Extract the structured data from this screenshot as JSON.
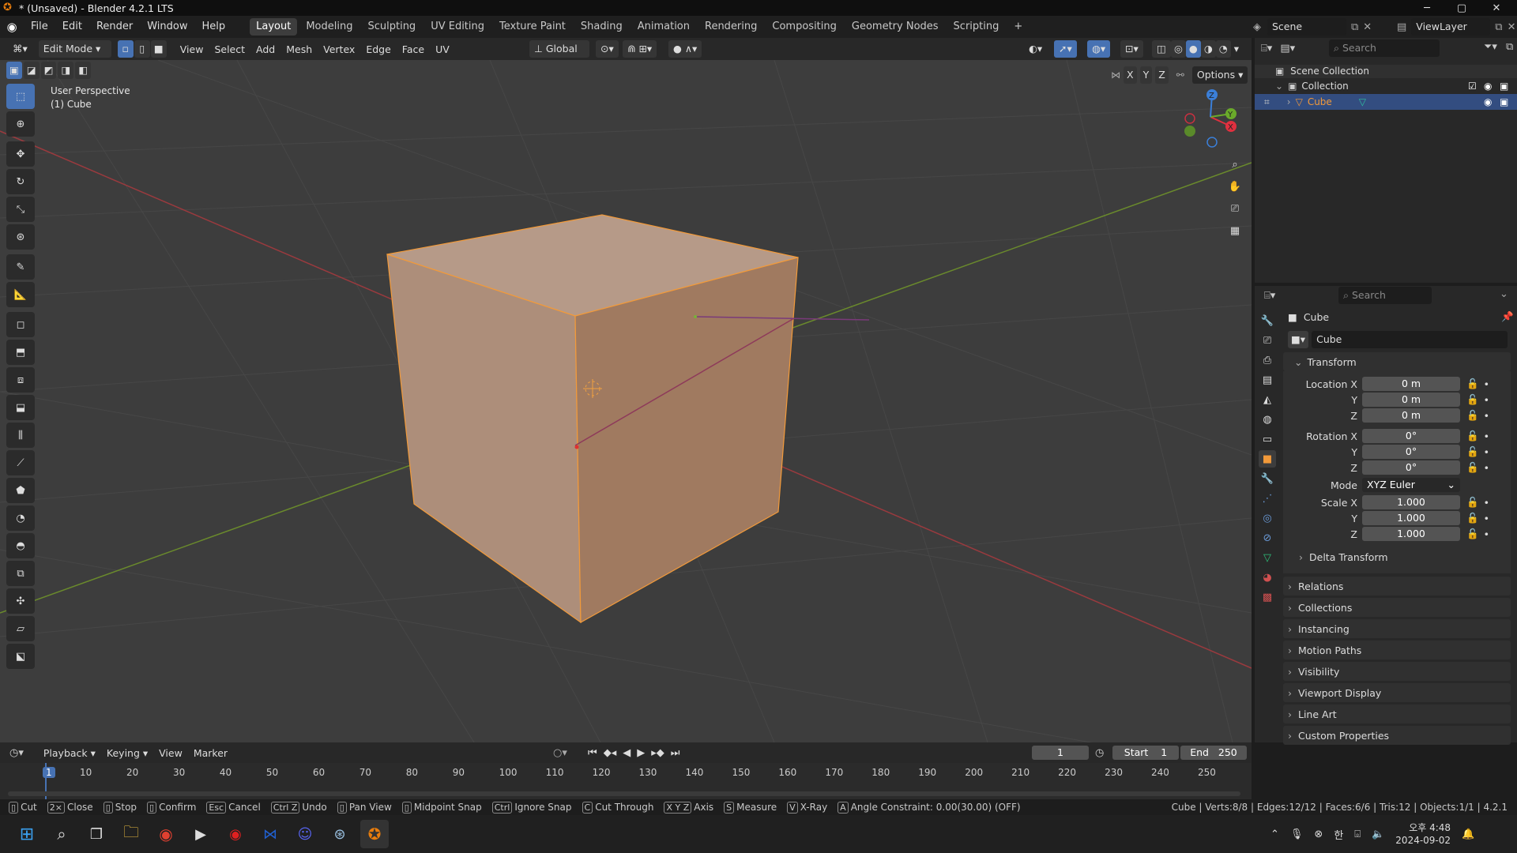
{
  "window": {
    "title": "* (Unsaved) - Blender 4.2.1 LTS",
    "controls": {
      "minimize": "─",
      "maximize": "▢",
      "close": "✕"
    }
  },
  "menubar": {
    "menus": [
      "File",
      "Edit",
      "Render",
      "Window",
      "Help"
    ],
    "workspaces": [
      "Layout",
      "Modeling",
      "Sculpting",
      "UV Editing",
      "Texture Paint",
      "Shading",
      "Animation",
      "Rendering",
      "Compositing",
      "Geometry Nodes",
      "Scripting"
    ],
    "active_workspace": "Layout",
    "add_tab": "+",
    "scene": "Scene",
    "view_layer": "ViewLayer"
  },
  "viewport_header": {
    "mode": "Edit Mode",
    "menus": [
      "View",
      "Select",
      "Add",
      "Mesh",
      "Vertex",
      "Edge",
      "Face",
      "UV"
    ],
    "transform_orientation": "Global",
    "axes": [
      "X",
      "Y",
      "Z"
    ],
    "options": "Options"
  },
  "viewport": {
    "perspective": "User Perspective",
    "object_label": "(1) Cube",
    "gizmo": {
      "x": "X",
      "y": "Y",
      "z": "Z"
    }
  },
  "outliner": {
    "search_placeholder": "Search",
    "scene_collection": "Scene Collection",
    "collection": "Collection",
    "object": "Cube"
  },
  "properties": {
    "search_placeholder": "Search",
    "object_header": "Cube",
    "object_name": "Cube",
    "transform_title": "Transform",
    "location": {
      "label": "Location X",
      "x": "0 m",
      "y": "0 m",
      "z": "0 m"
    },
    "rotation": {
      "label": "Rotation X",
      "x": "0°",
      "y": "0°",
      "z": "0°"
    },
    "mode": {
      "label": "Mode",
      "value": "XYZ Euler"
    },
    "scale": {
      "label": "Scale X",
      "x": "1.000",
      "y": "1.000",
      "z": "1.000"
    },
    "axis_y": "Y",
    "axis_z": "Z",
    "delta_transform": "Delta Transform",
    "panels": [
      "Relations",
      "Collections",
      "Instancing",
      "Motion Paths",
      "Visibility",
      "Viewport Display",
      "Line Art",
      "Custom Properties"
    ]
  },
  "timeline": {
    "menus": [
      "Playback",
      "Keying",
      "View",
      "Marker"
    ],
    "current_frame": "1",
    "start_label": "Start",
    "start": "1",
    "end_label": "End",
    "end": "250",
    "ticks": [
      "1",
      "10",
      "20",
      "30",
      "40",
      "50",
      "60",
      "70",
      "80",
      "90",
      "100",
      "110",
      "120",
      "130",
      "140",
      "150",
      "160",
      "170",
      "180",
      "190",
      "200",
      "210",
      "220",
      "230",
      "240",
      "250"
    ]
  },
  "statusbar": {
    "hints": [
      {
        "key": "",
        "label": "Cut"
      },
      {
        "key": "2×",
        "label": "Close"
      },
      {
        "key": "",
        "label": "Stop"
      },
      {
        "key": "",
        "label": "Confirm"
      },
      {
        "key": "Esc",
        "label": "Cancel"
      },
      {
        "key": "Ctrl Z",
        "label": "Undo"
      },
      {
        "key": "",
        "label": "Pan View"
      },
      {
        "key": "",
        "label": "Midpoint Snap"
      },
      {
        "key": "Ctrl",
        "label": "Ignore Snap"
      },
      {
        "key": "C",
        "label": "Cut Through"
      },
      {
        "key": "X Y Z",
        "label": "Axis"
      },
      {
        "key": "S",
        "label": "Measure"
      },
      {
        "key": "V",
        "label": "X-Ray"
      },
      {
        "key": "A",
        "label": "Angle Constraint: 0.00(30.00) (OFF)"
      }
    ],
    "stats": "Cube | Verts:8/8 | Edges:12/12 | Faces:6/6 | Tris:12 | Objects:1/1 | 4.2.1"
  },
  "taskbar": {
    "time": "오후 4:48",
    "date": "2024-09-02",
    "ime": "한"
  }
}
